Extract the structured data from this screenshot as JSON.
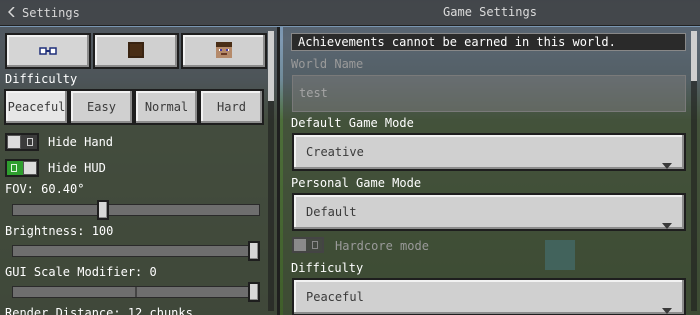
{
  "header": {
    "back_label": "Settings",
    "title": "Game Settings"
  },
  "left": {
    "difficulty_label": "Difficulty",
    "difficulty_options": [
      "Peaceful",
      "Easy",
      "Normal",
      "Hard"
    ],
    "difficulty_selected": "Peaceful",
    "hide_hand": {
      "label": "Hide Hand",
      "on": false
    },
    "hide_hud": {
      "label": "Hide HUD",
      "on": true
    },
    "fov": {
      "label": "FOV: 60.40°",
      "level": 0.36
    },
    "brightness": {
      "label": "Brightness: 100",
      "level": 1.0
    },
    "gui_scale": {
      "label": "GUI Scale Modifier: 0",
      "level": 1.0
    },
    "render_distance_label": "Render Distance: 12 chunks"
  },
  "right": {
    "banner": "Achievements cannot be earned in this world.",
    "world_name_label": "World Name",
    "world_name_value": "test",
    "default_game_mode_label": "Default Game Mode",
    "default_game_mode_value": "Creative",
    "personal_game_mode_label": "Personal Game Mode",
    "personal_game_mode_value": "Default",
    "hardcore_label": "Hardcore mode",
    "hardcore_on": false,
    "difficulty_label": "Difficulty",
    "difficulty_value": "Peaceful"
  },
  "colors": {
    "toggle_on": "#2e9e2e",
    "button_face": "#d0d0d0",
    "panel_border": "#1e1e1e"
  },
  "icons": [
    "chevron-left-icon",
    "camera-view-icon",
    "steve-back-icon",
    "steve-face-icon",
    "caret-down-icon"
  ]
}
